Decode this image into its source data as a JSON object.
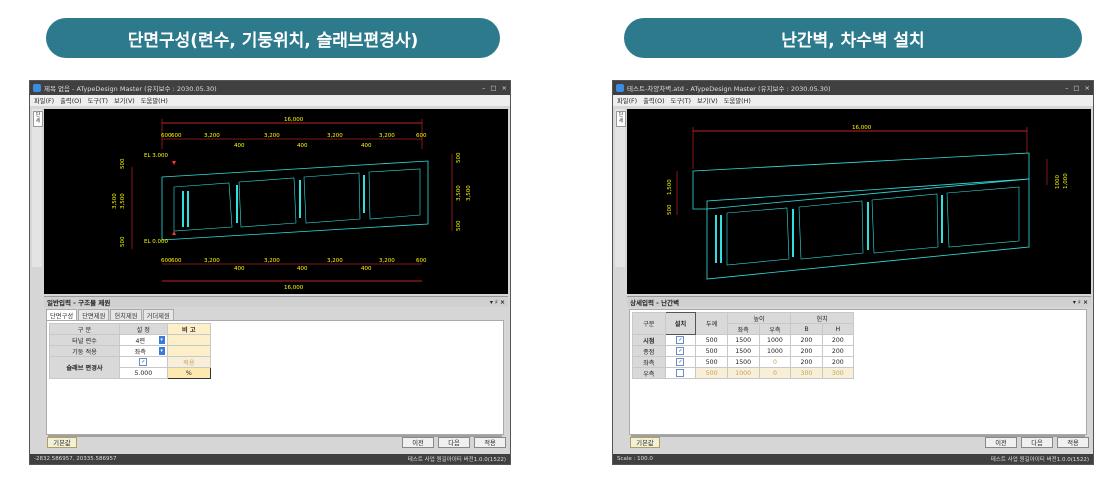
{
  "left": {
    "pill": "단면구성(련수, 기둥위치, 슬래브편경사)",
    "window": {
      "title": "제목 없음 - ATypeDesign Master  (유지보수 : 2030.05.30)",
      "menus": [
        "파일(F)",
        "출력(O)",
        "도구(T)",
        "보기(V)",
        "도움말(H)"
      ],
      "vtab": "단\n세",
      "panel_title": "일반입력 - 구조물 제원",
      "tabs": [
        "단면구성",
        "단면제원",
        "헌치제원",
        "거더제원"
      ],
      "table": {
        "headers": [
          "구 분",
          "설 정",
          "비 고"
        ],
        "rows": [
          {
            "label": "터널 련수",
            "value": "4련"
          },
          {
            "label": "기둥 적용",
            "value": "좌측"
          }
        ],
        "slab_label": "슬래브 편경사",
        "slab_apply": "적용",
        "slab_value": "5.000",
        "slab_unit": "%"
      },
      "buttons": {
        "default": "기본값",
        "prev": "이전",
        "next": "다음",
        "apply": "적용"
      },
      "status_left": "-2832.586957,  20335.586957",
      "status_right": "테스트 사업   원길아이티   버전1.0.0(1522)"
    },
    "cad": {
      "total": "16,000",
      "top_dims": [
        "600",
        "600",
        "3,200",
        "3,200",
        "3,200",
        "3,200",
        "600"
      ],
      "top_sub": [
        "400",
        "400",
        "400"
      ],
      "left_dims": [
        "500",
        "3,500",
        "3,500",
        "500"
      ],
      "right_dims": [
        "500",
        "3,500",
        "3,500",
        "500"
      ],
      "el_top": "EL 3.000",
      "el_bottom": "EL 0.000"
    }
  },
  "right": {
    "pill": "난간벽, 차수벽 설치",
    "window": {
      "title": "테스트-차양차벽.atd - ATypeDesign Master  (유지보수 : 2030.05.30)",
      "menus": [
        "파일(F)",
        "출력(O)",
        "도구(T)",
        "보기(V)",
        "도움말(H)"
      ],
      "vtab": "단\n세",
      "panel_title": "상세입력 - 난간벽",
      "table": {
        "headers": {
          "group": "구분",
          "install": "설치",
          "thickness": "두께",
          "height": "높이",
          "haunch": "헌치",
          "left": "좌측",
          "right": "우측",
          "b": "B",
          "h": "H"
        },
        "rows": [
          {
            "name": "시점",
            "checked": true,
            "t": "500",
            "hl": "1500",
            "hr": "1000",
            "b": "200",
            "h": "200"
          },
          {
            "name": "종점",
            "checked": true,
            "t": "500",
            "hl": "1500",
            "hr": "1000",
            "b": "200",
            "h": "200"
          },
          {
            "name": "좌측",
            "checked": true,
            "t": "500",
            "hl": "1500",
            "hr": "0",
            "b": "200",
            "h": "200"
          },
          {
            "name": "우측",
            "checked": false,
            "t": "500",
            "hl": "1000",
            "hr": "0",
            "b": "300",
            "h": "300"
          }
        ]
      },
      "buttons": {
        "default": "기본값",
        "prev": "이전",
        "next": "다음",
        "apply": "적용"
      },
      "status_left": "Scale : 100.0",
      "status_right": "테스트 사업   원길아이티   버전1.0.0(1522)"
    },
    "cad": {
      "total": "16,000",
      "left_dims": [
        "500",
        "1,500"
      ],
      "right_dims": [
        "1000",
        "1,000"
      ]
    }
  }
}
